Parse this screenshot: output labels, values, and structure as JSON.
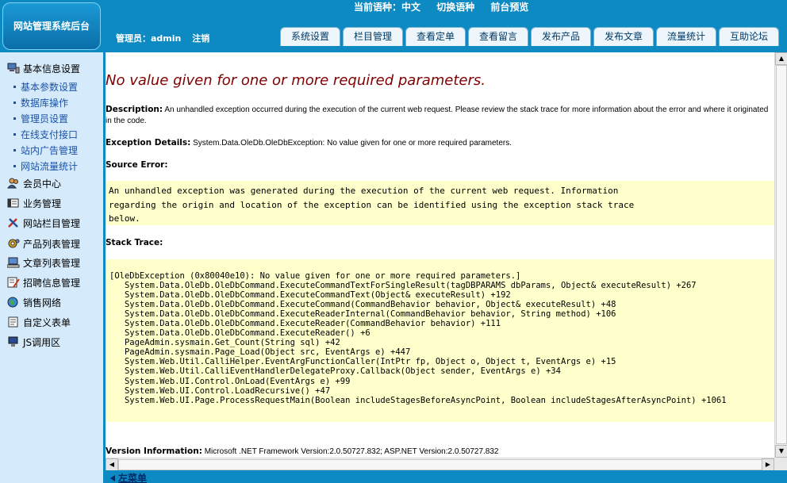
{
  "header": {
    "logo_text": "网站管理系统后台",
    "current_lang_label": "当前语种：中文",
    "switch_lang": "切换语种",
    "preview": "前台预览",
    "admin_label": "管理员：admin",
    "logout": "注销"
  },
  "tabs": [
    "系统设置",
    "栏目管理",
    "查看定单",
    "查看留言",
    "发布产品",
    "发布文章",
    "流量统计",
    "互助论坛"
  ],
  "sidebar": {
    "basic_group": "基本信息设置",
    "basic_items": [
      "基本参数设置",
      "数据库操作",
      "管理员设置",
      "在线支付接口",
      "站内广告管理",
      "网站流量统计"
    ],
    "groups": [
      "会员中心",
      "业务管理",
      "网站栏目管理",
      "产品列表管理",
      "文章列表管理",
      "招聘信息管理",
      "销售网络",
      "自定义表单",
      "JS调用区"
    ]
  },
  "error": {
    "title": "No value given for one or more required parameters.",
    "description_label": "Description:",
    "description_text": "An unhandled exception occurred during the execution of the current web request. Please review the stack trace for more information about the error and where it originated in the code.",
    "exception_label": "Exception Details:",
    "exception_text": "System.Data.OleDb.OleDbException: No value given for one or more required parameters.",
    "source_error_label": "Source Error:",
    "source_error_lines": [
      "An unhandled exception was generated during the execution of the current web request. Information",
      "regarding the origin and location of the exception can be identified using the exception stack trace",
      "below."
    ],
    "stack_trace_label": "Stack Trace:",
    "stack_lines": [
      "[OleDbException (0x80040e10): No value given for one or more required parameters.]",
      "   System.Data.OleDb.OleDbCommand.ExecuteCommandTextForSingleResult(tagDBPARAMS dbParams, Object& executeResult) +267",
      "   System.Data.OleDb.OleDbCommand.ExecuteCommandText(Object& executeResult) +192",
      "   System.Data.OleDb.OleDbCommand.ExecuteCommand(CommandBehavior behavior, Object& executeResult) +48",
      "   System.Data.OleDb.OleDbCommand.ExecuteReaderInternal(CommandBehavior behavior, String method) +106",
      "   System.Data.OleDb.OleDbCommand.ExecuteReader(CommandBehavior behavior) +111",
      "   System.Data.OleDb.OleDbCommand.ExecuteReader() +6",
      "   PageAdmin.sysmain.Get_Count(String sql) +42",
      "   PageAdmin.sysmain.Page_Load(Object src, EventArgs e) +447",
      "   System.Web.Util.CalliHelper.EventArgFunctionCaller(IntPtr fp, Object o, Object t, EventArgs e) +15",
      "   System.Web.Util.CalliEventHandlerDelegateProxy.Callback(Object sender, EventArgs e) +34",
      "   System.Web.UI.Control.OnLoad(EventArgs e) +99",
      "   System.Web.UI.Control.LoadRecursive() +47",
      "   System.Web.UI.Page.ProcessRequestMain(Boolean includeStagesBeforeAsyncPoint, Boolean includeStagesAfterAsyncPoint) +1061"
    ],
    "version_label": "Version Information:",
    "version_text": "Microsoft .NET Framework Version:2.0.50727.832; ASP.NET Version:2.0.50727.832"
  },
  "footer": {
    "left_menu": "左菜单"
  },
  "colors": {
    "header_blue": "#0E8AC2",
    "sidebar_bg": "#D5EAFA",
    "error_title": "#800000",
    "code_bg": "#FFFFCC",
    "link_blue": "#1A52A8"
  }
}
